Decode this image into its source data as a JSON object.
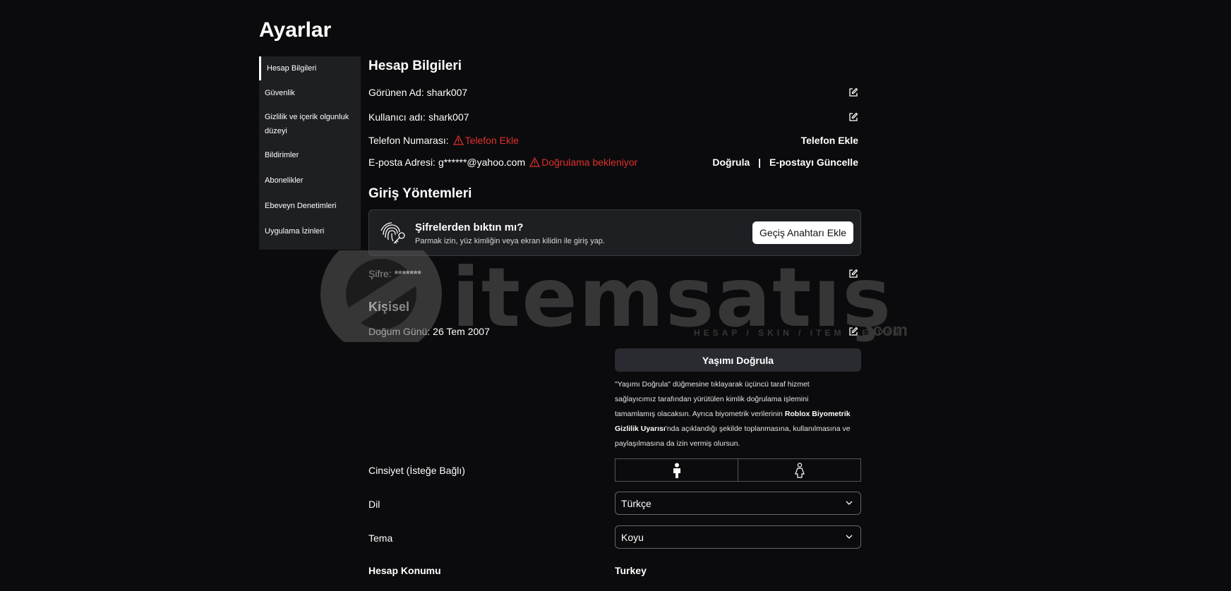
{
  "page_title": "Ayarlar",
  "sidebar": {
    "items": [
      {
        "label": "Hesap Bilgileri"
      },
      {
        "label": "Güvenlik"
      },
      {
        "label": "Gizlilik ve içerik olgunluk"
      },
      {
        "label": "düzeyi"
      },
      {
        "label": "Bildirimler"
      },
      {
        "label": "Abonelikler"
      },
      {
        "label": "Ebeveyn Denetimleri"
      },
      {
        "label": "Uygulama İzinleri"
      }
    ]
  },
  "account": {
    "title": "Hesap Bilgileri",
    "display_name_label": "Görünen Ad:",
    "display_name": "shark007",
    "username_label": "Kullanıcı adı:",
    "username": "shark007",
    "phone_label": "Telefon Numarası:",
    "phone_warning": "Telefon Ekle",
    "phone_action": "Telefon Ekle",
    "email_label": "E-posta Adresi:",
    "email": "g******@yahoo.com",
    "email_warning": "Doğrulama bekleniyor",
    "verify_action": "Doğrula",
    "separator": "|",
    "update_email_action": "E-postayı Güncelle"
  },
  "login": {
    "title": "Giriş Yöntemleri",
    "passkey_title": "Şifrelerden bıktın mı?",
    "passkey_sub": "Parmak izin, yüz kimliğin veya ekran kilidin ile giriş yap.",
    "passkey_button": "Geçiş Anahtarı Ekle",
    "password_label": "Şifre:",
    "password_value": "*******"
  },
  "personal": {
    "title": "Kişisel",
    "birthday_label": "Doğum Günü:",
    "birthday": "26 Tem 2007",
    "verify_age_button": "Yaşımı Doğrula",
    "age_text_1": "\"Yaşımı Doğrula\" düğmesine tıklayarak üçüncü taraf hizmet",
    "age_text_2": "sağlayıcımız tarafından yürütülen kimlik doğrulama işlemini",
    "age_text_3a": "tamamlamış olacaksın. Ayrıca biyometrik verilerinin ",
    "age_text_3b": "Roblox Biyometrik",
    "age_text_4a": "Gizlilik Uyarısı",
    "age_text_4b": "'nda açıklandığı şekilde toplanmasına, kullanılmasına ve",
    "age_text_5": "paylaşılmasına da izin vermiş olursun.",
    "gender_label": "Cinsiyet (İsteğe Bağlı)",
    "language_label": "Dil",
    "language_value": "Türkçe",
    "theme_label": "Tema",
    "theme_value": "Koyu",
    "location_label": "Hesap Konumu",
    "location_value": "Turkey"
  },
  "watermark": {
    "text": "itemsatış",
    "sub": "HESAP / SKIN / ITEM / E-PIN",
    "com": ".com"
  },
  "colors": {
    "background": "#0b0b0d",
    "panel": "#1e1f23",
    "warning": "#e0302c"
  }
}
